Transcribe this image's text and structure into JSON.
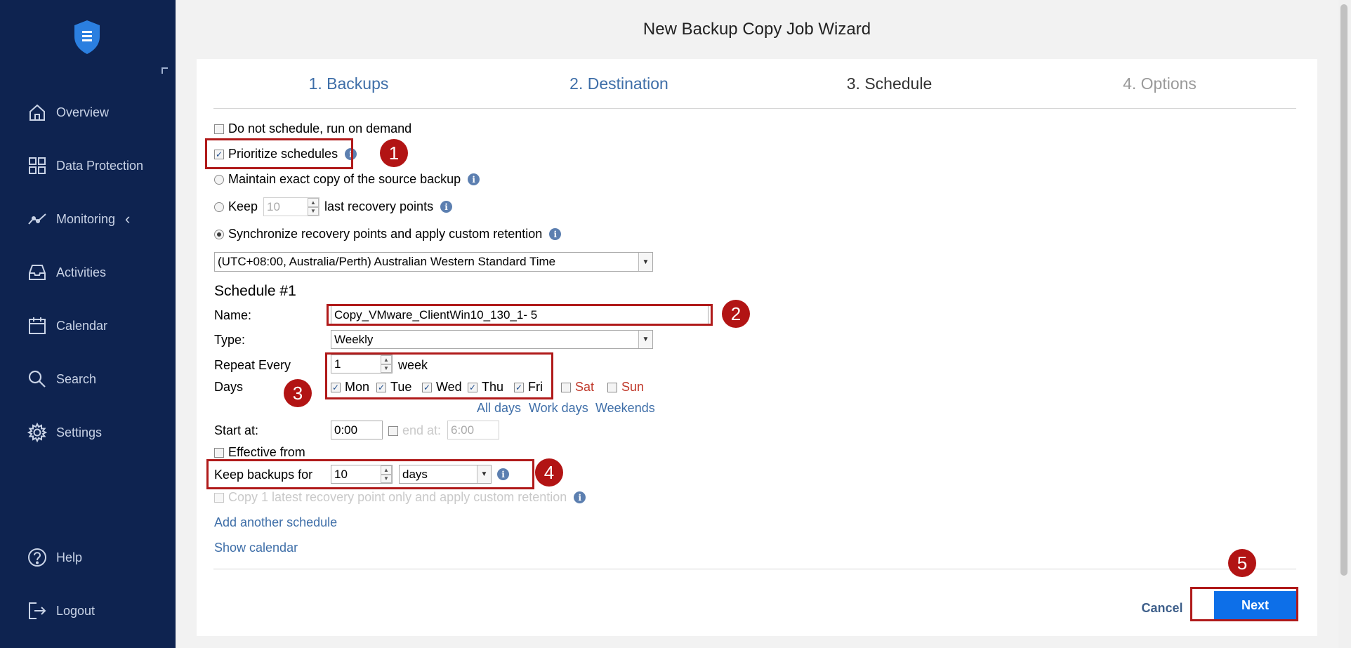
{
  "nav": {
    "items": [
      {
        "label": "Overview",
        "icon": "home-icon"
      },
      {
        "label": "Data Protection",
        "icon": "grid-icon"
      },
      {
        "label": "Monitoring",
        "icon": "chart-line-icon"
      },
      {
        "label": "Activities",
        "icon": "inbox-icon"
      },
      {
        "label": "Calendar",
        "icon": "calendar-icon"
      },
      {
        "label": "Search",
        "icon": "search-icon"
      },
      {
        "label": "Settings",
        "icon": "gear-icon"
      }
    ],
    "help": "Help",
    "logout": "Logout"
  },
  "wizard": {
    "title": "New Backup Copy Job Wizard",
    "tabs": [
      "1. Backups",
      "2. Destination",
      "3. Schedule",
      "4. Options"
    ]
  },
  "options": {
    "no_schedule": "Do not schedule, run on demand",
    "prioritize": "Prioritize schedules",
    "maintain_exact": "Maintain exact copy of the source backup",
    "keep_prefix": "Keep",
    "keep_value": "10",
    "keep_suffix": "last recovery points",
    "sync": "Synchronize recovery points and apply custom retention",
    "timezone": "(UTC+08:00, Australia/Perth) Australian Western Standard Time"
  },
  "schedule": {
    "heading": "Schedule #1",
    "name_label": "Name:",
    "name_value": "Copy_VMware_ClientWin10_130_1- 5",
    "type_label": "Type:",
    "type_value": "Weekly",
    "repeat_label": "Repeat Every",
    "repeat_value": "1",
    "repeat_unit": "week",
    "days_label": "Days",
    "days": [
      {
        "label": "Mon",
        "checked": true
      },
      {
        "label": "Tue",
        "checked": true
      },
      {
        "label": "Wed",
        "checked": true
      },
      {
        "label": "Thu",
        "checked": true
      },
      {
        "label": "Fri",
        "checked": true
      },
      {
        "label": "Sat",
        "checked": false
      },
      {
        "label": "Sun",
        "checked": false
      }
    ],
    "all_days": "All days",
    "work_days": "Work days",
    "weekends": "Weekends",
    "start_label": "Start at:",
    "start_value": "0:00",
    "end_label": "end at:",
    "end_value": "6:00",
    "effective_from": "Effective from",
    "keep_label": "Keep backups for",
    "keep_value": "10",
    "keep_unit": "days",
    "copy_latest": "Copy 1 latest recovery point only and apply custom retention",
    "add_another": "Add another schedule",
    "show_calendar": "Show calendar"
  },
  "buttons": {
    "cancel": "Cancel",
    "next": "Next"
  },
  "annotations": [
    "1",
    "2",
    "3",
    "4",
    "5"
  ],
  "colors": {
    "sidebar": "#0e2350",
    "link": "#3e6ea8",
    "highlight": "#b01a1a",
    "next_button": "#0d6fe8"
  }
}
